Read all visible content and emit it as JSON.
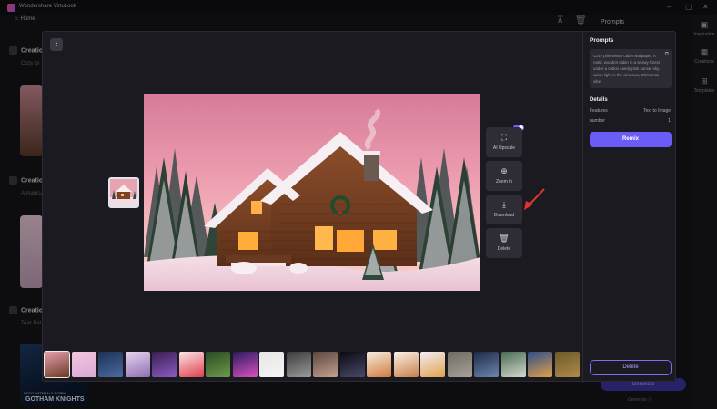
{
  "app": {
    "name": "Wondershare VirtuLook",
    "home_label": "Home",
    "prompts_tab": "Prompts"
  },
  "background": {
    "sections": [
      {
        "title": "Creatio",
        "subtitle": "Cozy pi"
      },
      {
        "title": "Creatio",
        "subtitle": "A magical"
      },
      {
        "title": "Creatio",
        "subtitle": "Tear Bat"
      }
    ],
    "rail": [
      {
        "label": "Inspiration",
        "icon": "image-icon"
      },
      {
        "label": "Creations",
        "icon": "grid-icon"
      },
      {
        "label": "Templates",
        "icon": "layout-icon"
      }
    ],
    "generate_label": "Generate",
    "generate_sub": "Generate ⓘ",
    "poster_line1": "LEGO BATMAN & ROBIN",
    "poster_line2": "GOTHAM KNIGHTS"
  },
  "modal": {
    "back_icon": "back-arrow-icon",
    "actions": [
      {
        "label": "AI Upscale",
        "icon": "upscale-icon"
      },
      {
        "label": "Zoom in",
        "icon": "zoom-in-icon"
      },
      {
        "label": "Download",
        "icon": "download-icon"
      },
      {
        "label": "Delete",
        "icon": "trash-icon"
      }
    ],
    "image_subject": "pink winter cabin",
    "thumbnails": [
      {
        "theme": "cabin",
        "colors": [
          "#e7a0ae",
          "#6a3a23"
        ]
      },
      {
        "theme": "pink-snow",
        "colors": [
          "#f4c6dc",
          "#d9a9d8"
        ]
      },
      {
        "theme": "batman-lego",
        "colors": [
          "#1d3254",
          "#4a6aa0"
        ]
      },
      {
        "theme": "fairy",
        "colors": [
          "#e6d5f0",
          "#8f6fb2"
        ]
      },
      {
        "theme": "purple-dark",
        "colors": [
          "#3a1d52",
          "#8b5cc4"
        ]
      },
      {
        "theme": "strawberry-pattern",
        "colors": [
          "#fbe4e8",
          "#e0404d"
        ]
      },
      {
        "theme": "green-pattern",
        "colors": [
          "#2a4a24",
          "#6d9b4a"
        ]
      },
      {
        "theme": "neon-street",
        "colors": [
          "#2a1c5c",
          "#d94fc0"
        ]
      },
      {
        "theme": "t-shirt",
        "colors": [
          "#e6e6e6",
          "#f5f5f5"
        ]
      },
      {
        "theme": "fashion-dark",
        "colors": [
          "#3b3b3b",
          "#9b9b9b"
        ]
      },
      {
        "theme": "portrait-collage",
        "colors": [
          "#5b4740",
          "#c3a18e"
        ]
      },
      {
        "theme": "night-sky",
        "colors": [
          "#0a0a12",
          "#4a4a6a"
        ]
      },
      {
        "theme": "stickers",
        "colors": [
          "#f5efe4",
          "#d27a3a"
        ]
      },
      {
        "theme": "pattern-food",
        "colors": [
          "#faf2e6",
          "#c9804a"
        ]
      },
      {
        "theme": "pastel-icons",
        "colors": [
          "#f3ecf7",
          "#e0a34a"
        ]
      },
      {
        "theme": "stone",
        "colors": [
          "#6d6a62",
          "#a8a39a"
        ]
      },
      {
        "theme": "warrior",
        "colors": [
          "#1f2a44",
          "#6b86b0"
        ]
      },
      {
        "theme": "person-green",
        "colors": [
          "#4a6b52",
          "#d3d9cf"
        ]
      },
      {
        "theme": "colorful-art",
        "colors": [
          "#2d4f8a",
          "#e3a04a"
        ]
      },
      {
        "theme": "fantasy-painting",
        "colors": [
          "#6a5a2a",
          "#b08a4a"
        ]
      }
    ]
  },
  "panel": {
    "prompts_title": "Prompts",
    "prompt_text": "Cozy pink winter cabin wallpaper. A rustic wooden cabin in a snowy forest under a cotton candy pink sunset sky, warm light in the windows, Christmas vibe.",
    "details_title": "Details",
    "details": [
      {
        "key": "Features",
        "value": "Text to Image"
      },
      {
        "key": "number",
        "value": "1"
      }
    ],
    "remix_label": "Remix",
    "delete_label": "Delete"
  },
  "colors": {
    "accent": "#6b5cf6",
    "annotation_arrow": "#e0322e"
  }
}
